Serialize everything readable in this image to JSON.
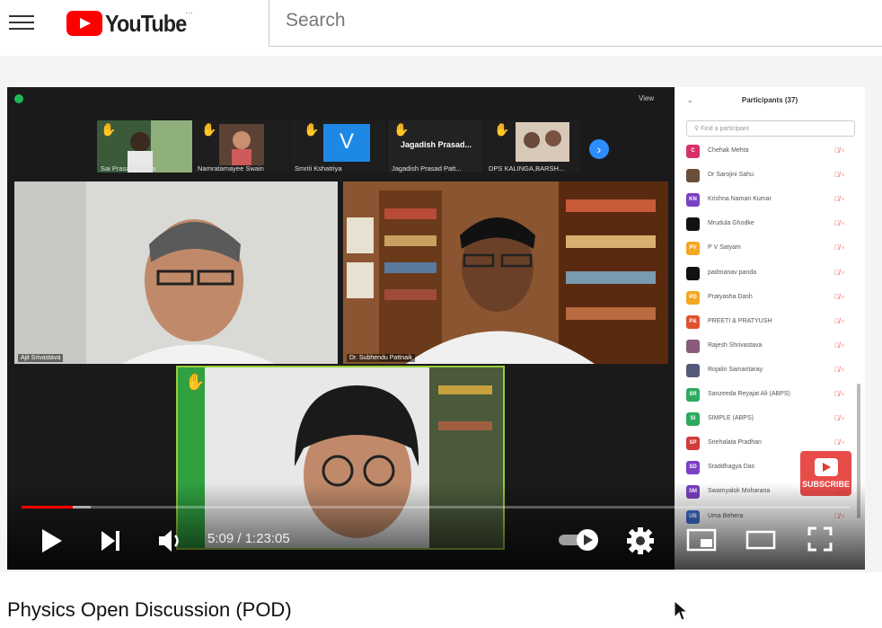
{
  "header": {
    "logo_text": "YouTube",
    "logo_suffix": "···",
    "search_placeholder": "Search"
  },
  "zoom": {
    "view_label": "View",
    "thumbnails": [
      {
        "name": "Sai Prasad Mishra"
      },
      {
        "name": "Namratamayee Swain"
      },
      {
        "name": "Smriti Kshatriya",
        "initial": "V"
      },
      {
        "name": "Jagadish Prasad Patt...",
        "title": "Jagadish Prasad..."
      },
      {
        "name": "DPS KALINGA,BARSH..."
      }
    ],
    "tiles": {
      "left": "Ajit Srivastava",
      "right": "Dr. Subhendu Pattnaik"
    }
  },
  "participants": {
    "title": "Participants (37)",
    "find_placeholder": "Find a participant",
    "list": [
      {
        "initials": "C",
        "name": "Chehak Mehta",
        "color": "#d8316a"
      },
      {
        "initials": "",
        "name": "Dr Sarojini Sahu",
        "color": "#6b4f3a"
      },
      {
        "initials": "KN",
        "name": "Krishna Naman Kumar",
        "color": "#7a3fc4"
      },
      {
        "initials": "",
        "name": "Mrudula Ghodke",
        "color": "#111111"
      },
      {
        "initials": "PV",
        "name": "P V Satyam",
        "color": "#f5a623"
      },
      {
        "initials": "",
        "name": "padmanav panda",
        "color": "#111111"
      },
      {
        "initials": "PD",
        "name": "Pratyasha Dash",
        "color": "#f5a623"
      },
      {
        "initials": "P&",
        "name": "PREETI & PRATYUSH",
        "color": "#e0512e"
      },
      {
        "initials": "",
        "name": "Rajesh Shrivastava",
        "color": "#8a5a7a"
      },
      {
        "initials": "",
        "name": "Rojalin Samantaray",
        "color": "#555a7a"
      },
      {
        "initials": "SR",
        "name": "Sanzeeda Reyajat Ali (ABPS)",
        "color": "#2eaa5e"
      },
      {
        "initials": "SI",
        "name": "SIMPLE (ABPS)",
        "color": "#2eaa5e"
      },
      {
        "initials": "SP",
        "name": "Snehalata Pradhan",
        "color": "#d13b3b"
      },
      {
        "initials": "SD",
        "name": "Sraddhagya Das",
        "color": "#7a3fc4"
      },
      {
        "initials": "SM",
        "name": "Swamyalok Moharana",
        "color": "#7a3fc4"
      },
      {
        "initials": "UB",
        "name": "Uma Behera",
        "color": "#3d6fd1"
      }
    ]
  },
  "player": {
    "time": "5:09 / 1:23:05",
    "progress_fraction": 0.062,
    "buffered_fraction": 0.083,
    "subscribe_label": "SUBSCRIBE"
  },
  "video": {
    "title": "Physics Open Discussion (POD)"
  }
}
